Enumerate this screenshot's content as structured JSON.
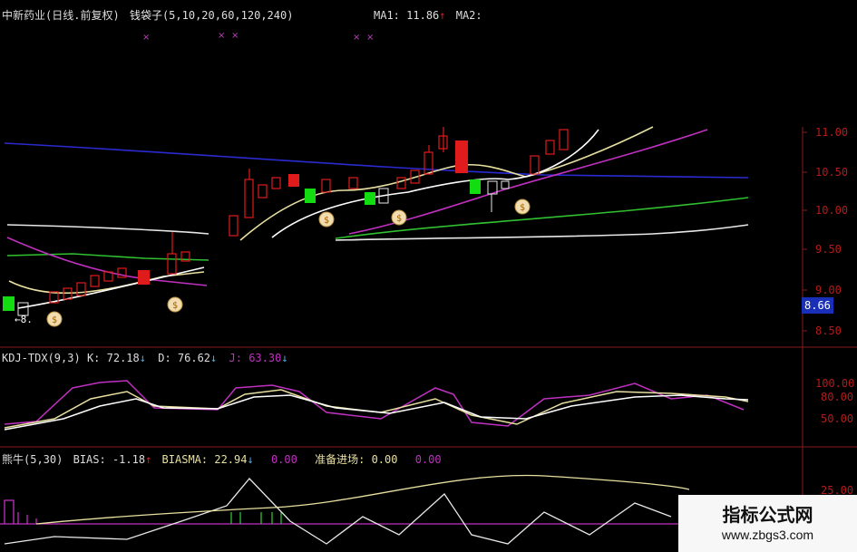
{
  "title": {
    "stock": "中新药业",
    "period": "(日线.前复权)",
    "indicator": "钱袋子",
    "params": "(5,10,20,60,120,240)",
    "ma1_label": "MA1:",
    "ma1_value": "11.86",
    "ma2_label": "MA2:"
  },
  "price_axis": {
    "ticks": [
      "11.00",
      "10.50",
      "10.00",
      "9.50",
      "9.00",
      "8.50"
    ],
    "current": "8.66"
  },
  "markers": {
    "low_label": "←8."
  },
  "kdj": {
    "name": "KDJ-TDX(9,3)",
    "k_label": "K:",
    "k_value": "72.18",
    "d_label": "D:",
    "d_value": "76.62",
    "j_label": "J:",
    "j_value": "63.30",
    "ticks": [
      "100.00",
      "80.00",
      "50.00"
    ]
  },
  "bias": {
    "name": "熊牛(5,30)",
    "bias_label": "BIAS:",
    "bias_value": "-1.18",
    "biasma_label": "BIASMA:",
    "biasma_value": "22.94",
    "v3": "0.00",
    "ready_label": "准备进场:",
    "ready_value": "0.00",
    "v5": "0.00",
    "ticks": [
      "25.00"
    ]
  },
  "watermark": {
    "title": "指标公式网",
    "url": "www.zbgs3.com"
  },
  "colors": {
    "up": "#e01b1b",
    "down": "#11dd11",
    "ma_white": "#e8e8e8",
    "ma_yellow": "#e8e0a0",
    "ma_magenta": "#c030c0",
    "ma_green": "#30c030",
    "ma_blue": "#2a2ad0",
    "axis_red": "#b31b1b"
  }
}
